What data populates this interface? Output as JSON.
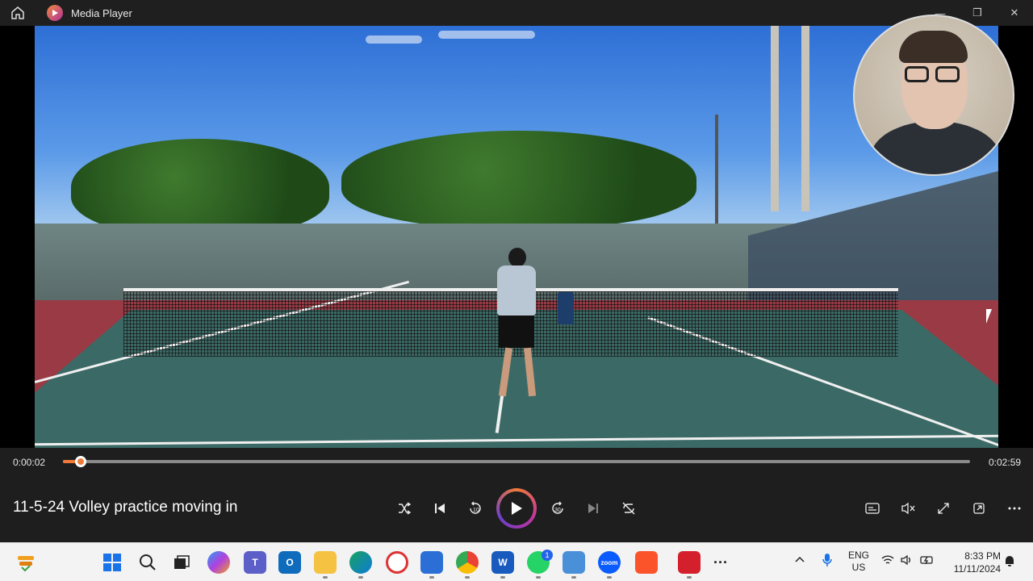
{
  "window": {
    "app_title": "Media Player",
    "minimize": "—",
    "restore": "❐",
    "close": "✕"
  },
  "player": {
    "elapsed": "0:00:02",
    "duration": "0:02:59",
    "progress_fraction": 0.02,
    "media_title": "11-5-24 Volley practice moving in",
    "skip_back_label": "10",
    "skip_forward_label": "30"
  },
  "taskbar": {
    "language_line1": "ENG",
    "language_line2": "US",
    "time": "8:33 PM",
    "date": "11/11/2024",
    "whatsapp_badge": "1",
    "zoom_label": "zoom"
  },
  "colors": {
    "accent": "#ef7a3a",
    "controls_bg": "#1e1e1e"
  }
}
